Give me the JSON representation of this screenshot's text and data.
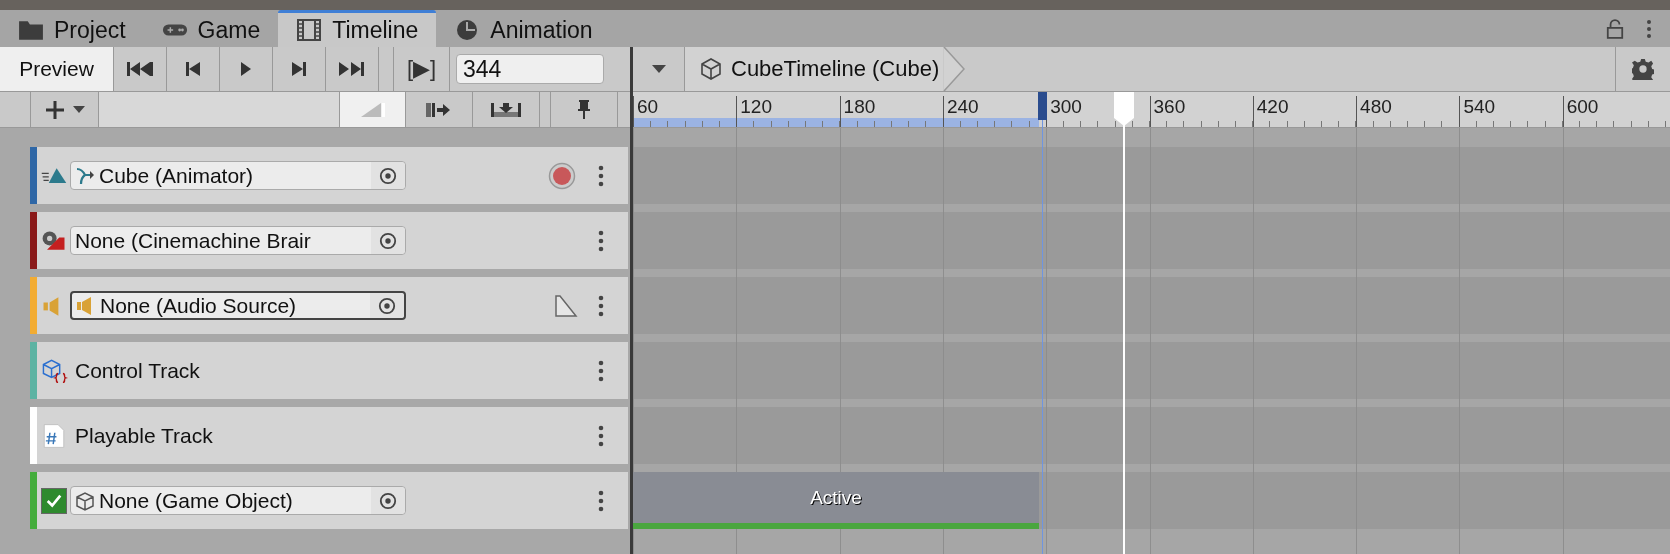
{
  "tabs": [
    {
      "kind": "folder",
      "label": "Project",
      "selected": false
    },
    {
      "kind": "gamepad",
      "label": "Game",
      "selected": false
    },
    {
      "kind": "film",
      "label": "Timeline",
      "selected": true
    },
    {
      "kind": "clock",
      "label": "Animation",
      "selected": false
    }
  ],
  "toolbar": {
    "preview": {
      "label": "Preview",
      "on": true
    },
    "play_range": {
      "label": "[▶]"
    },
    "frame": {
      "value": "344"
    }
  },
  "breadcrumb": "CubeTimeline (Cube)",
  "ruler": {
    "ticks": [
      "60",
      "120",
      "180",
      "240",
      "300",
      "360",
      "420",
      "480",
      "540",
      "600"
    ]
  },
  "tracks": [
    {
      "kind": "animation",
      "color": "#2f67a6",
      "field": {
        "value": "Cube (Animator)",
        "focused": false
      }
    },
    {
      "kind": "cinemachine",
      "color": "#8a1919",
      "field": {
        "value": "None (Cinemachine Brair",
        "focused": false
      }
    },
    {
      "kind": "audio",
      "color": "#f2ac33",
      "field": {
        "value": "None (Audio Source)",
        "focused": true
      }
    },
    {
      "kind": "control",
      "color": "#5cb3a3",
      "label": "Control Track"
    },
    {
      "kind": "playable",
      "color": "#ffffff",
      "label": "Playable Track"
    },
    {
      "kind": "activation",
      "color": "#44ac3c",
      "checked": true,
      "field": {
        "value": "None (Game Object)",
        "focused": false
      },
      "clip": {
        "label": "Active"
      }
    }
  ]
}
